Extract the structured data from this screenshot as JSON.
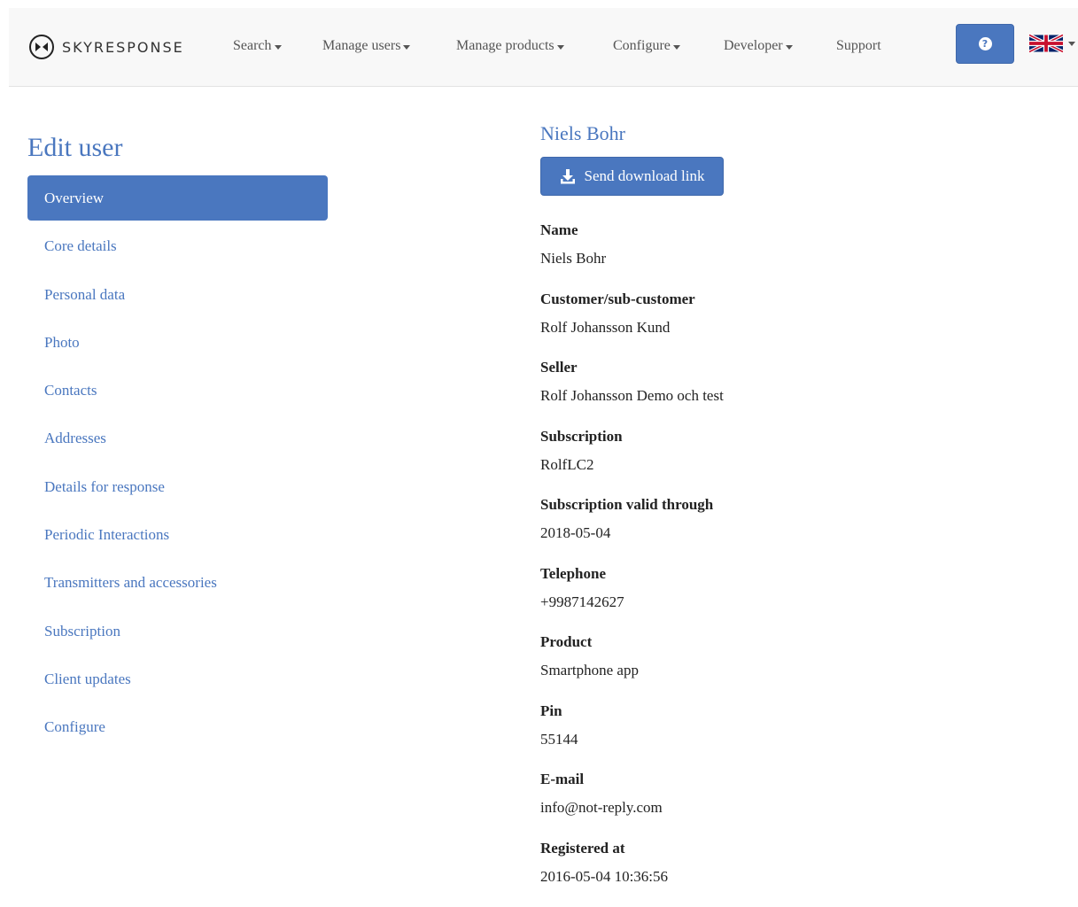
{
  "brand": {
    "name": "SKYRESPONSE"
  },
  "nav": {
    "items": [
      {
        "label": "Search",
        "dropdown": true
      },
      {
        "label": "Manage users",
        "dropdown": true
      },
      {
        "label": "Manage products",
        "dropdown": true
      },
      {
        "label": "Configure",
        "dropdown": true
      },
      {
        "label": "Developer",
        "dropdown": true
      },
      {
        "label": "Support",
        "dropdown": false
      }
    ],
    "help_icon": "question-circle-icon",
    "language_icon": "uk-flag-icon"
  },
  "sidebar": {
    "title": "Edit user",
    "items": [
      {
        "label": "Overview",
        "active": true
      },
      {
        "label": "Core details"
      },
      {
        "label": "Personal data"
      },
      {
        "label": "Photo"
      },
      {
        "label": "Contacts"
      },
      {
        "label": "Addresses"
      },
      {
        "label": "Details for response"
      },
      {
        "label": "Periodic Interactions"
      },
      {
        "label": "Transmitters and accessories"
      },
      {
        "label": "Subscription"
      },
      {
        "label": "Client updates"
      },
      {
        "label": "Configure"
      }
    ]
  },
  "main": {
    "user_name": "Niels Bohr",
    "send_button": {
      "label": "Send download link",
      "icon": "download-icon"
    },
    "fields": [
      {
        "label": "Name",
        "value": "Niels Bohr"
      },
      {
        "label": "Customer/sub-customer",
        "value": "Rolf Johansson Kund"
      },
      {
        "label": "Seller",
        "value": "Rolf Johansson Demo och test"
      },
      {
        "label": "Subscription",
        "value": "RolfLC2"
      },
      {
        "label": "Subscription valid through",
        "value": "2018-05-04"
      },
      {
        "label": "Telephone",
        "value": "+9987142627"
      },
      {
        "label": "Product",
        "value": "Smartphone app"
      },
      {
        "label": "Pin",
        "value": "55144"
      },
      {
        "label": "E-mail",
        "value": "info@not-reply.com"
      },
      {
        "label": "Registered at",
        "value": "2016-05-04 10:36:56"
      }
    ]
  },
  "colors": {
    "accent": "#4a77bf",
    "navbar_bg": "#f8f8f8",
    "text": "#222222"
  }
}
